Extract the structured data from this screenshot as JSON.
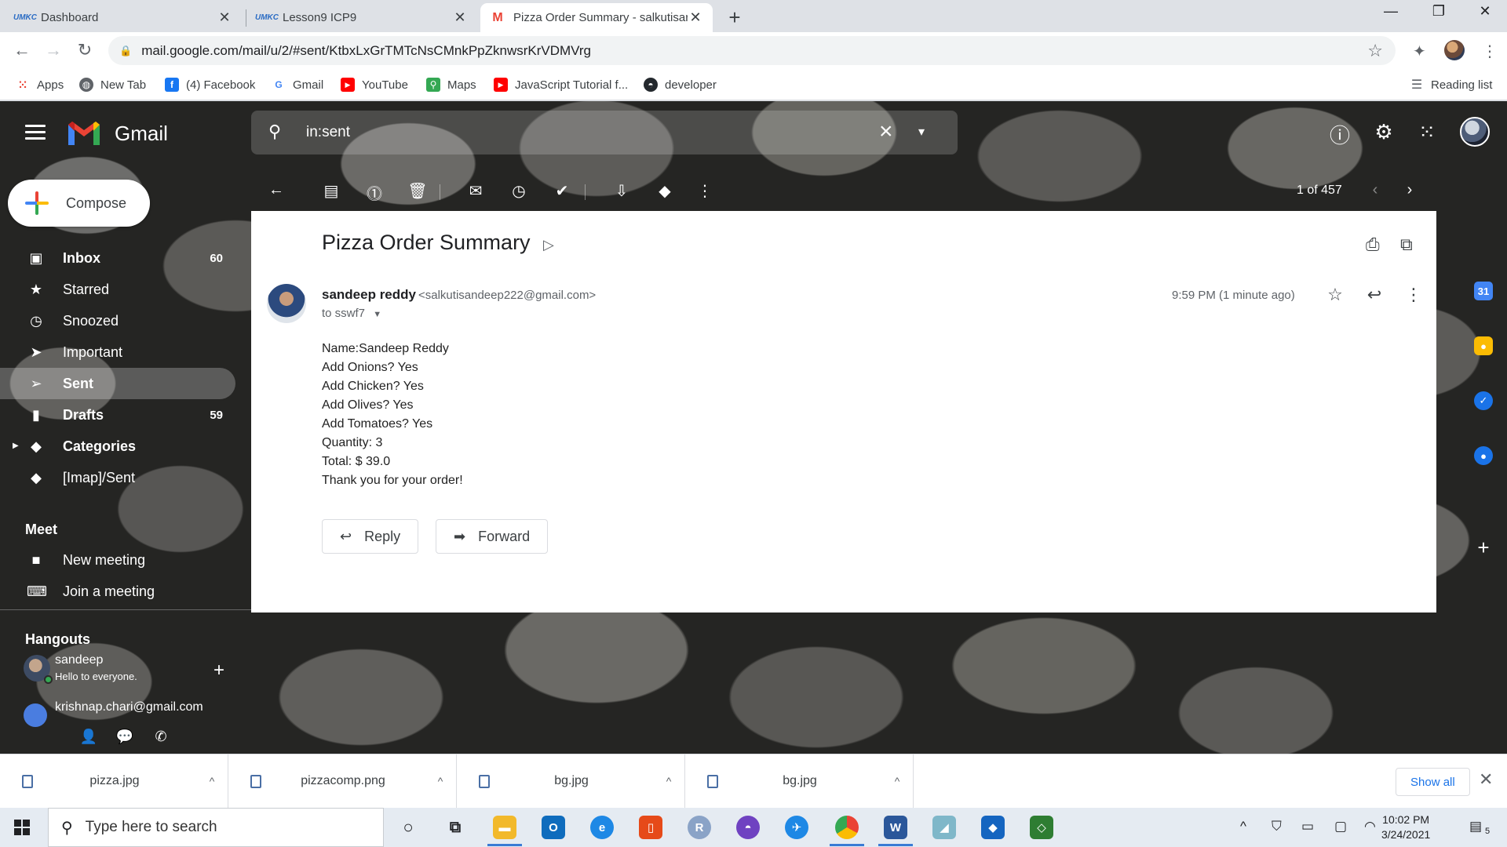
{
  "browser": {
    "tabs": [
      {
        "title": "Dashboard",
        "favicon": "umkc-logo-icon",
        "active": false
      },
      {
        "title": "Lesson9 ICP9",
        "favicon": "umkc-logo-icon",
        "active": false
      },
      {
        "title": "Pizza Order Summary - salkutisar",
        "favicon": "gmail-icon",
        "active": true
      }
    ],
    "url": "mail.google.com/mail/u/2/#sent/KtbxLxGrTMTcNsCMnkPpZknwsrKrVDMVrg",
    "bookmarks": [
      "Apps",
      "New Tab",
      "(4) Facebook",
      "Gmail",
      "YouTube",
      "Maps",
      "JavaScript Tutorial f...",
      "developer"
    ],
    "reading_list": "Reading list"
  },
  "gmail": {
    "brand": "Gmail",
    "search_value": "in:sent",
    "compose_label": "Compose",
    "nav": [
      {
        "label": "Inbox",
        "count": "60",
        "icon": "inbox-icon"
      },
      {
        "label": "Starred",
        "count": "",
        "icon": "star-icon"
      },
      {
        "label": "Snoozed",
        "count": "",
        "icon": "clock-icon"
      },
      {
        "label": "Important",
        "count": "",
        "icon": "important-icon"
      },
      {
        "label": "Sent",
        "count": "",
        "icon": "send-icon",
        "active": true
      },
      {
        "label": "Drafts",
        "count": "59",
        "icon": "draft-icon"
      },
      {
        "label": "Categories",
        "count": "",
        "icon": "label-icon"
      },
      {
        "label": "[Imap]/Sent",
        "count": "",
        "icon": "label-icon"
      }
    ],
    "meet": {
      "title": "Meet",
      "new_meeting": "New meeting",
      "join_meeting": "Join a meeting"
    },
    "hangouts": {
      "title": "Hangouts",
      "user_name": "sandeep",
      "user_status": "Hello to everyone.",
      "contact": "krishnap.chari@gmail.com"
    },
    "pager": "1 of 457",
    "message": {
      "subject": "Pizza Order Summary",
      "sender_name": "sandeep reddy",
      "sender_email": "<salkutisandeep222@gmail.com>",
      "recipient": "to sswf7",
      "time": "9:59 PM (1 minute ago)",
      "body": [
        "Name:Sandeep Reddy",
        "Add Onions? Yes",
        "Add Chicken? Yes",
        "Add Olives? Yes",
        "Add Tomatoes? Yes",
        "Quantity: 3",
        "Total: $ 39.0",
        "Thank you for your order!"
      ],
      "reply_label": "Reply",
      "forward_label": "Forward"
    }
  },
  "downloads": {
    "files": [
      "pizza.jpg",
      "pizzacomp.png",
      "bg.jpg",
      "bg.jpg"
    ],
    "show_all": "Show all"
  },
  "taskbar": {
    "search_placeholder": "Type here to search",
    "time": "10:02 PM",
    "date": "3/24/2021",
    "notifications": "5"
  }
}
